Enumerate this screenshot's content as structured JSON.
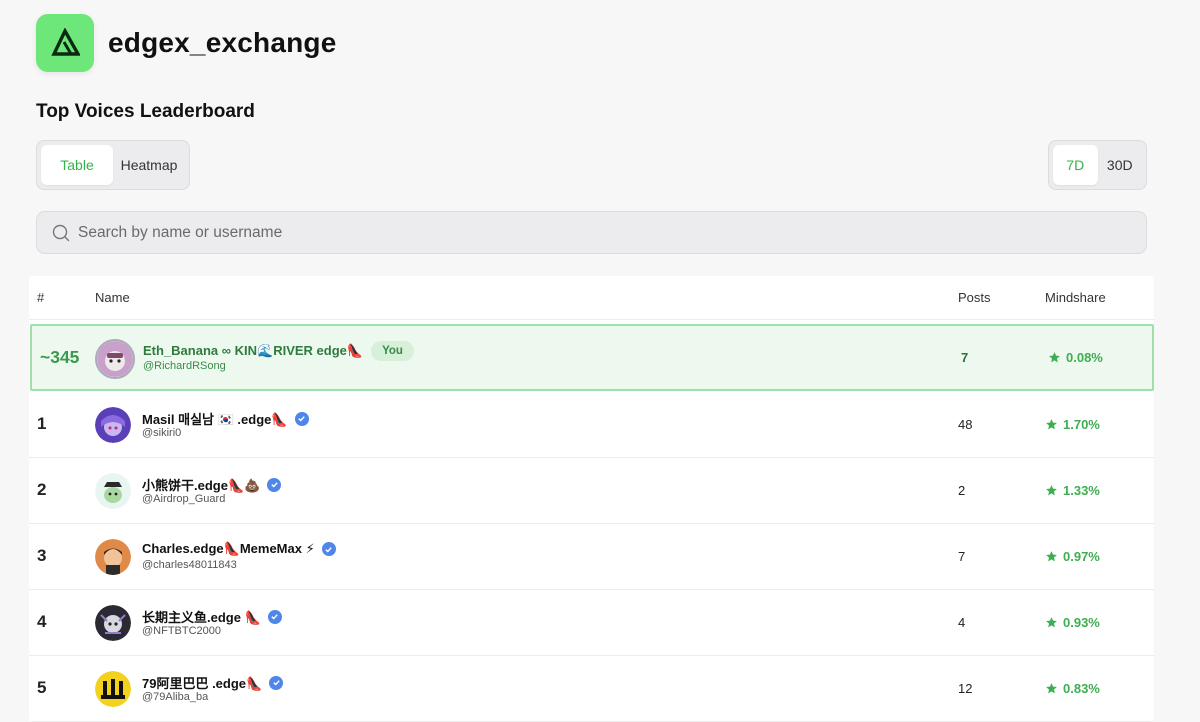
{
  "brand": {
    "name": "edgex_exchange",
    "accent": "#6ee77a"
  },
  "title": "Top Voices Leaderboard",
  "view_toggle": {
    "options": [
      "Table",
      "Heatmap"
    ],
    "selected": "Table"
  },
  "range_toggle": {
    "options": [
      "7D",
      "30D"
    ],
    "selected": "7D"
  },
  "search": {
    "placeholder": "Search by name or username",
    "value": ""
  },
  "table": {
    "headers": {
      "rank": "#",
      "name": "Name",
      "posts": "Posts",
      "mindshare": "Mindshare"
    },
    "you_row": {
      "rank": "~345",
      "name": "Eth_Banana ∞ KIN🌊RIVER edge👠",
      "badge": "You",
      "handle": "@RichardRSong",
      "posts": "7",
      "mindshare": "0.08%"
    },
    "rows": [
      {
        "rank": "1",
        "name": "Masil 매실남 🇰🇷 .edge👠",
        "handle": "@sikiri0",
        "posts": "48",
        "mindshare": "1.70%",
        "verified": true
      },
      {
        "rank": "2",
        "name": "小熊饼干.edge👠💩",
        "handle": "@Airdrop_Guard",
        "posts": "2",
        "mindshare": "1.33%",
        "verified": true
      },
      {
        "rank": "3",
        "name": "Charles.edge👠MemeMax ⚡",
        "handle": "@charles48011843",
        "posts": "7",
        "mindshare": "0.97%",
        "verified": true
      },
      {
        "rank": "4",
        "name": "长期主义鱼.edge 👠",
        "handle": "@NFTBTC2000",
        "posts": "4",
        "mindshare": "0.93%",
        "verified": true
      },
      {
        "rank": "5",
        "name": "79阿里巴巴 .edge👠",
        "handle": "@79Aliba_ba",
        "posts": "12",
        "mindshare": "0.83%",
        "verified": true
      }
    ]
  },
  "icons": {
    "search": "search-icon",
    "mindshare": "star-icon",
    "verified": "verified-check-icon"
  }
}
